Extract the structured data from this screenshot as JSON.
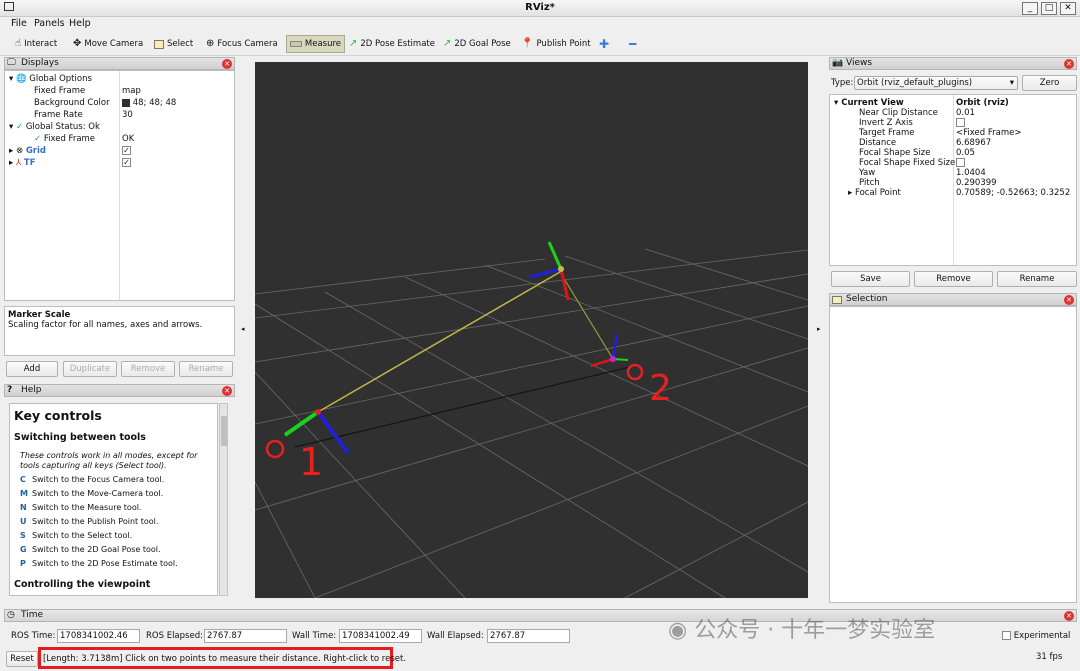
{
  "window": {
    "title": "RViz*",
    "min": "_",
    "max": "□",
    "close": "✕"
  },
  "menu": [
    "File",
    "Panels",
    "Help"
  ],
  "toolbar": {
    "interact": "Interact",
    "move_camera": "Move Camera",
    "select": "Select",
    "focus_camera": "Focus Camera",
    "measure": "Measure",
    "pose_estimate": "2D Pose Estimate",
    "goal_pose": "2D Goal Pose",
    "publish_point": "Publish Point"
  },
  "displays": {
    "title": "Displays",
    "rows": [
      {
        "name": "Global Options",
        "value": ""
      },
      {
        "name": "Fixed Frame",
        "value": "map"
      },
      {
        "name": "Background Color",
        "value": "48; 48; 48"
      },
      {
        "name": "Frame Rate",
        "value": "30"
      },
      {
        "name": "Global Status: Ok",
        "value": ""
      },
      {
        "name": "Fixed Frame",
        "value": "OK"
      },
      {
        "name": "Grid",
        "value": "✓"
      },
      {
        "name": "TF",
        "value": "✓"
      }
    ],
    "desc_title": "Marker Scale",
    "desc_text": "Scaling factor for all names, axes and arrows.",
    "buttons": {
      "add": "Add",
      "duplicate": "Duplicate",
      "remove": "Remove",
      "rename": "Rename"
    }
  },
  "help": {
    "title": "Help",
    "heading": "Key controls",
    "sub1": "Switching between tools",
    "note": "These controls work in all modes, except for tools capturing all keys (Select tool).",
    "keys": [
      {
        "k": "C",
        "t": "Switch to the Focus Camera tool."
      },
      {
        "k": "M",
        "t": "Switch to the Move-Camera tool."
      },
      {
        "k": "N",
        "t": "Switch to the Measure tool."
      },
      {
        "k": "U",
        "t": "Switch to the Publish Point tool."
      },
      {
        "k": "S",
        "t": "Switch to the Select tool."
      },
      {
        "k": "G",
        "t": "Switch to the 2D Goal Pose tool."
      },
      {
        "k": "P",
        "t": "Switch to the 2D Pose Estimate tool."
      }
    ],
    "sub2": "Controlling the viewpoint"
  },
  "views": {
    "title": "Views",
    "type_label": "Type:",
    "type_value": "Orbit (rviz_default_plugins)",
    "zero": "Zero",
    "current_view": "Current View",
    "current_value": "Orbit (rviz)",
    "props": [
      {
        "name": "Near Clip Distance",
        "value": "0.01"
      },
      {
        "name": "Invert Z Axis",
        "value": ""
      },
      {
        "name": "Target Frame",
        "value": "<Fixed Frame>"
      },
      {
        "name": "Distance",
        "value": "6.68967"
      },
      {
        "name": "Focal Shape Size",
        "value": "0.05"
      },
      {
        "name": "Focal Shape Fixed Size",
        "value": ""
      },
      {
        "name": "Yaw",
        "value": "1.0404"
      },
      {
        "name": "Pitch",
        "value": "0.290399"
      },
      {
        "name": "Focal Point",
        "value": "0.70589; -0.52663; 0.3252"
      }
    ],
    "buttons": {
      "save": "Save",
      "remove": "Remove",
      "rename": "Rename"
    }
  },
  "selection": {
    "title": "Selection"
  },
  "time": {
    "title": "Time",
    "ros_time_label": "ROS Time:",
    "ros_time": "1708341002.46",
    "ros_elapsed_label": "ROS Elapsed:",
    "ros_elapsed": "2767.87",
    "wall_time_label": "Wall Time:",
    "wall_time": "1708341002.49",
    "wall_elapsed_label": "Wall Elapsed:",
    "wall_elapsed": "2767.87",
    "experimental": "Experimental"
  },
  "status": {
    "reset": "Reset",
    "message": "[Length: 3.7138m] Click on two points to measure their distance. Right-click to reset.",
    "fps": "31 fps"
  },
  "viewport": {
    "point1": "1",
    "point2": "2"
  },
  "watermark": "公众号 · 十年一梦实验室"
}
